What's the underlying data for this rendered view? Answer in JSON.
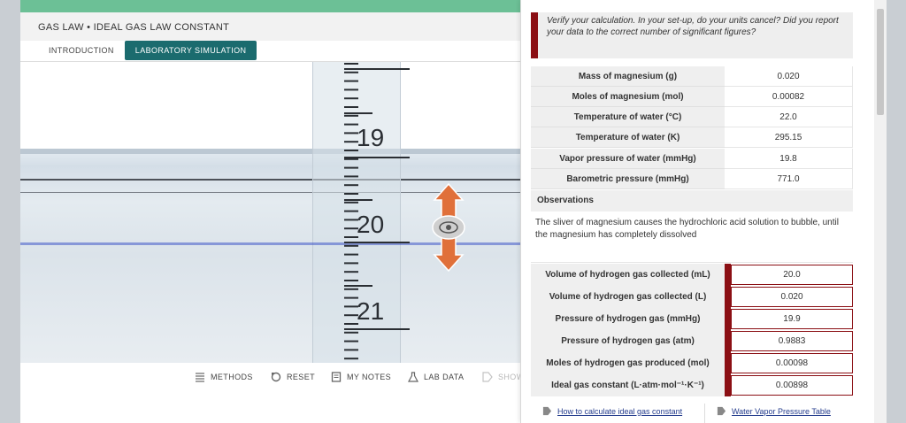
{
  "app": {
    "title": "GAS LAW • IDEAL GAS LAW CONSTANT",
    "tabs": [
      {
        "label": "INTRODUCTION",
        "active": false
      },
      {
        "label": "LABORATORY SIMULATION",
        "active": true
      }
    ]
  },
  "simulation": {
    "scale_numbers": [
      "19",
      "20",
      "21"
    ],
    "controls": {
      "up_down": "arrow-up-down-icon",
      "view": "eye-icon"
    }
  },
  "toolbar": {
    "methods": "METHODS",
    "reset": "RESET",
    "my_notes": "MY NOTES",
    "lab_data": "LAB DATA",
    "show": "SHOW"
  },
  "panel": {
    "notice": "Verify your calculation. In your set-up, do your units cancel? Did you report your data to the correct number of significant figures?",
    "data_rows": [
      {
        "label": "Mass of magnesium (g)",
        "value": "0.020"
      },
      {
        "label": "Moles of magnesium (mol)",
        "value": "0.00082"
      },
      {
        "label": "Temperature of water (°C)",
        "value": "22.0"
      },
      {
        "label": "Temperature of water (K)",
        "value": "295.15"
      },
      {
        "label": "Vapor pressure of water (mmHg)",
        "value": "19.8"
      },
      {
        "label": "Barometric pressure (mmHg)",
        "value": "771.0"
      }
    ],
    "observations_label": "Observations",
    "observations_text": "The sliver of magnesium causes the hydrochloric acid solution to bubble, until the magnesium has completely dissolved",
    "input_rows": [
      {
        "label": "Volume of hydrogen gas collected (mL)",
        "value": "20.0"
      },
      {
        "label": "Volume of hydrogen gas collected (L)",
        "value": "0.020"
      },
      {
        "label": "Pressure of hydrogen gas (mmHg)",
        "value": "19.9"
      },
      {
        "label": "Pressure of hydrogen gas (atm)",
        "value": "0.9883"
      },
      {
        "label": "Moles of hydrogen gas produced (mol)",
        "value": "0.00098"
      },
      {
        "label": "Ideal gas constant (L·atm·mol⁻¹·K⁻¹)",
        "value": "0.00898"
      }
    ],
    "links": [
      {
        "label": "How to calculate ideal gas constant"
      },
      {
        "label": "Water Vapor Pressure Table"
      }
    ]
  },
  "colors": {
    "accent_green": "#6cc096",
    "teal_tab": "#1b6b6e",
    "error_red": "#8b0f14",
    "link_blue": "#233b8c",
    "arrow_orange": "#e0703a"
  }
}
